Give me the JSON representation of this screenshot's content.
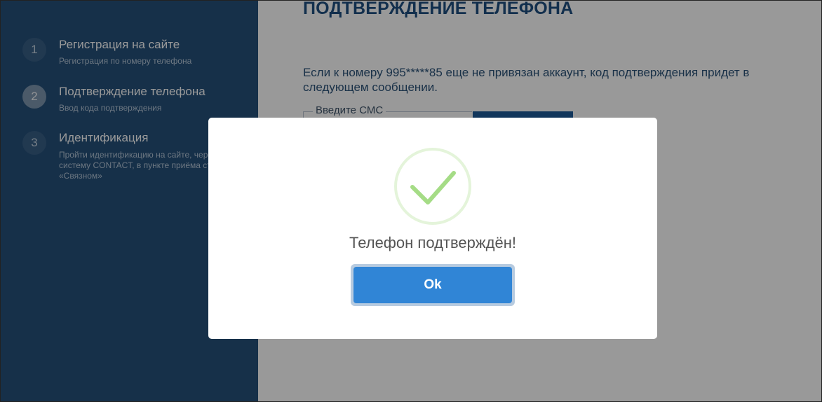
{
  "sidebar": {
    "steps": [
      {
        "number": "1",
        "title": "Регистрация на сайте",
        "subtitle": "Регистрация по номеру телефона"
      },
      {
        "number": "2",
        "title": "Подтверждение телефона",
        "subtitle": "Ввод кода подтверждения"
      },
      {
        "number": "3",
        "title": "Идентификация",
        "subtitle": "Пройти идентификацию на сайте, через «Госуслуги», систему CONTACT, в пункте приёма ставок или «Связном»"
      }
    ]
  },
  "main": {
    "title": "ПОДТВЕРЖДЕНИЕ ТЕЛЕФОНА",
    "info": "Если к номеру 995*****85 еще не привязан аккаунт, код подтверждения придет в следующем сообщении.",
    "sms_label": "Введите СМС"
  },
  "modal": {
    "icon": "success-check-icon",
    "message": "Телефон подтверждён!",
    "ok_label": "Ok"
  },
  "colors": {
    "sidebar_bg": "#25507a",
    "title": "#1f4f80",
    "success_green": "#a5dc86",
    "ok_button": "#3085d6",
    "overlay": "rgba(0,0,0,0.4)"
  }
}
